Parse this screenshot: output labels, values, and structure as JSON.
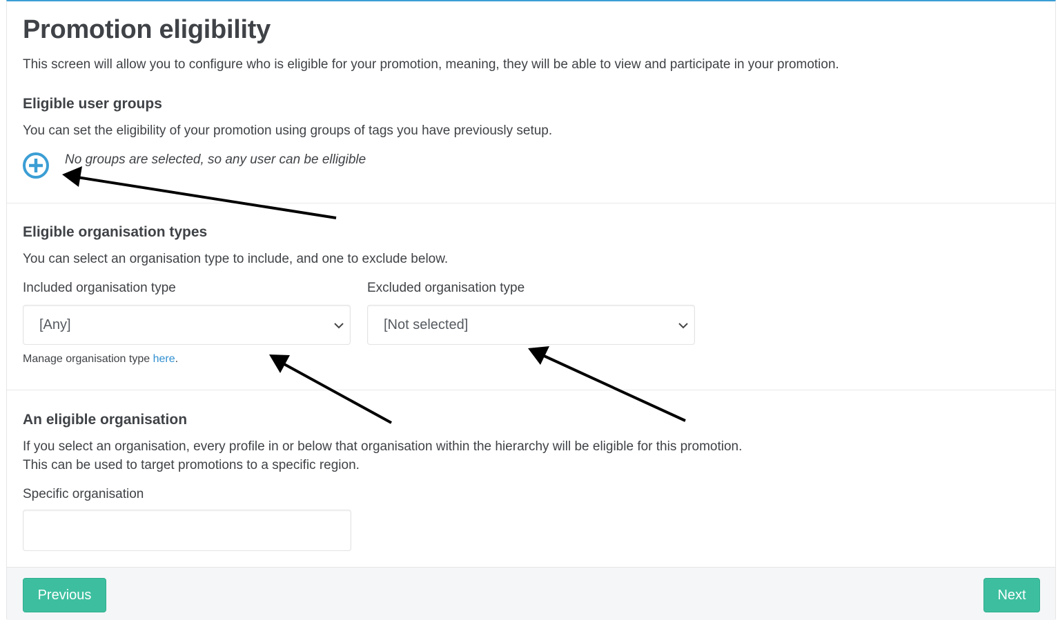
{
  "header": {
    "title": "Promotion eligibility",
    "intro": "This screen will allow you to configure who is eligible for your promotion, meaning, they will be able to view and participate in your promotion."
  },
  "user_groups": {
    "heading": "Eligible user groups",
    "description": "You can set the eligibility of your promotion using groups of tags you have previously setup.",
    "empty_note": "No groups are selected, so any user can be elligible",
    "add_icon": "plus-circle-icon"
  },
  "org_types": {
    "heading": "Eligible organisation types",
    "description": "You can select an organisation type to include, and one to exclude below.",
    "included_label": "Included organisation type",
    "included_value": "[Any]",
    "excluded_label": "Excluded organisation type",
    "excluded_value": "[Not selected]",
    "help_prefix": "Manage organisation type ",
    "help_link": "here",
    "help_suffix": "."
  },
  "organisation": {
    "heading": "An eligible organisation",
    "description_line1": "If you select an organisation, every profile in or below that organisation within the hierarchy will be eligible for this promotion.",
    "description_line2": "This can be used to target promotions to a specific region.",
    "field_label": "Specific organisation",
    "field_value": ""
  },
  "footer": {
    "previous_label": "Previous",
    "next_label": "Next"
  },
  "colors": {
    "accent_blue": "#3b9ed4",
    "button_green": "#3dbf9f",
    "link_blue": "#2f8fd0",
    "text": "#3f4246"
  }
}
